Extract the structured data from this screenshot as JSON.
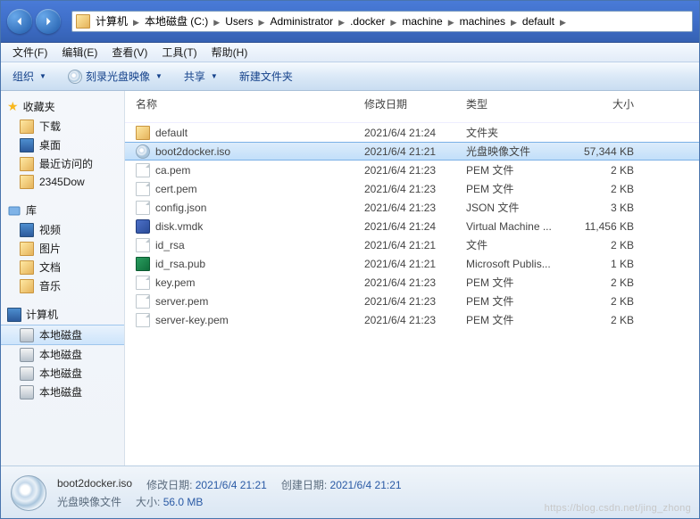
{
  "breadcrumb": [
    "计算机",
    "本地磁盘 (C:)",
    "Users",
    "Administrator",
    ".docker",
    "machine",
    "machines",
    "default"
  ],
  "menu": {
    "file": "文件(F)",
    "edit": "编辑(E)",
    "view": "查看(V)",
    "tools": "工具(T)",
    "help": "帮助(H)"
  },
  "toolbar": {
    "organize": "组织",
    "burn": "刻录光盘映像",
    "share": "共享",
    "newfolder": "新建文件夹"
  },
  "sidebar": {
    "fav_head": "收藏夹",
    "favs": [
      "下载",
      "桌面",
      "最近访问的",
      "2345Dow"
    ],
    "lib_head": "库",
    "libs": [
      "视频",
      "图片",
      "文档",
      "音乐"
    ],
    "comp_head": "计算机",
    "comps": [
      "本地磁盘",
      "本地磁盘",
      "本地磁盘",
      "本地磁盘"
    ],
    "comp_sel_index": 0
  },
  "columns": {
    "name": "名称",
    "date": "修改日期",
    "type": "类型",
    "size": "大小"
  },
  "files": [
    {
      "icon": "folder",
      "name": "default",
      "date": "2021/6/4 21:24",
      "type": "文件夹",
      "size": ""
    },
    {
      "icon": "disc",
      "name": "boot2docker.iso",
      "date": "2021/6/4 21:21",
      "type": "光盘映像文件",
      "size": "57,344 KB",
      "selected": true
    },
    {
      "icon": "file",
      "name": "ca.pem",
      "date": "2021/6/4 21:23",
      "type": "PEM 文件",
      "size": "2 KB"
    },
    {
      "icon": "file",
      "name": "cert.pem",
      "date": "2021/6/4 21:23",
      "type": "PEM 文件",
      "size": "2 KB"
    },
    {
      "icon": "file",
      "name": "config.json",
      "date": "2021/6/4 21:23",
      "type": "JSON 文件",
      "size": "3 KB"
    },
    {
      "icon": "vmdk",
      "name": "disk.vmdk",
      "date": "2021/6/4 21:24",
      "type": "Virtual Machine ...",
      "size": "11,456 KB"
    },
    {
      "icon": "file",
      "name": "id_rsa",
      "date": "2021/6/4 21:21",
      "type": "文件",
      "size": "2 KB"
    },
    {
      "icon": "pub",
      "name": "id_rsa.pub",
      "date": "2021/6/4 21:21",
      "type": "Microsoft Publis...",
      "size": "1 KB"
    },
    {
      "icon": "file",
      "name": "key.pem",
      "date": "2021/6/4 21:23",
      "type": "PEM 文件",
      "size": "2 KB"
    },
    {
      "icon": "file",
      "name": "server.pem",
      "date": "2021/6/4 21:23",
      "type": "PEM 文件",
      "size": "2 KB"
    },
    {
      "icon": "file",
      "name": "server-key.pem",
      "date": "2021/6/4 21:23",
      "type": "PEM 文件",
      "size": "2 KB"
    }
  ],
  "details": {
    "filename": "boot2docker.iso",
    "subtype": "光盘映像文件",
    "mod_label": "修改日期:",
    "mod_value": "2021/6/4 21:21",
    "size_label": "大小:",
    "size_value": "56.0 MB",
    "create_label": "创建日期:",
    "create_value": "2021/6/4 21:21"
  },
  "watermark": "https://blog.csdn.net/jing_zhong"
}
